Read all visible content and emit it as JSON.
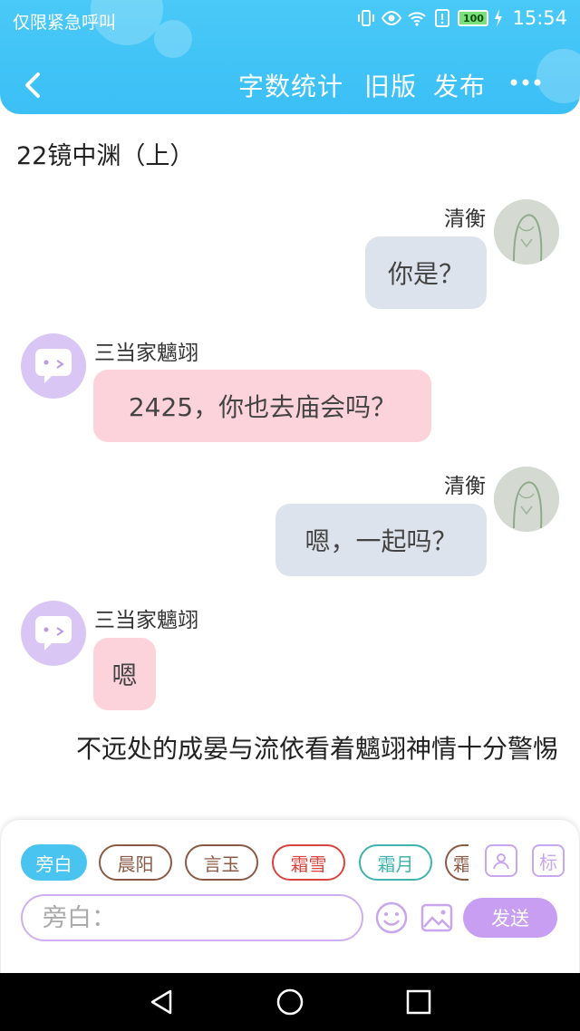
{
  "status": {
    "carrier": "仅限紧急呼叫",
    "battery": "100",
    "time": "15:54"
  },
  "nav": {
    "word_count": "字数统计",
    "old_version": "旧版",
    "publish": "发布"
  },
  "chapter_title": "22镜中渊（上）",
  "messages": [
    {
      "side": "right",
      "name": "清衡",
      "text": "你是？"
    },
    {
      "side": "left",
      "name": "三当家魑翊",
      "text": "2425，你也去庙会吗？"
    },
    {
      "side": "right",
      "name": "清衡",
      "text": "嗯，一起吗？"
    },
    {
      "side": "left",
      "name": "三当家魑翊",
      "text": "嗯"
    }
  ],
  "narration": "不远处的成晏与流依看着魑翊神情十分警惕",
  "roles": [
    {
      "label": "旁白",
      "color": "#49c3f0",
      "selected": true
    },
    {
      "label": "晨阳",
      "color": "#8a5a44",
      "selected": false
    },
    {
      "label": "言玉",
      "color": "#8a5a44",
      "selected": false
    },
    {
      "label": "霜雪",
      "color": "#d9443f",
      "selected": false
    },
    {
      "label": "霜月",
      "color": "#3fb3b0",
      "selected": false
    },
    {
      "label": "霜",
      "color": "#8a5a44",
      "selected": false
    }
  ],
  "tool_label": "标",
  "input_placeholder": "旁白：",
  "send_label": "发送"
}
